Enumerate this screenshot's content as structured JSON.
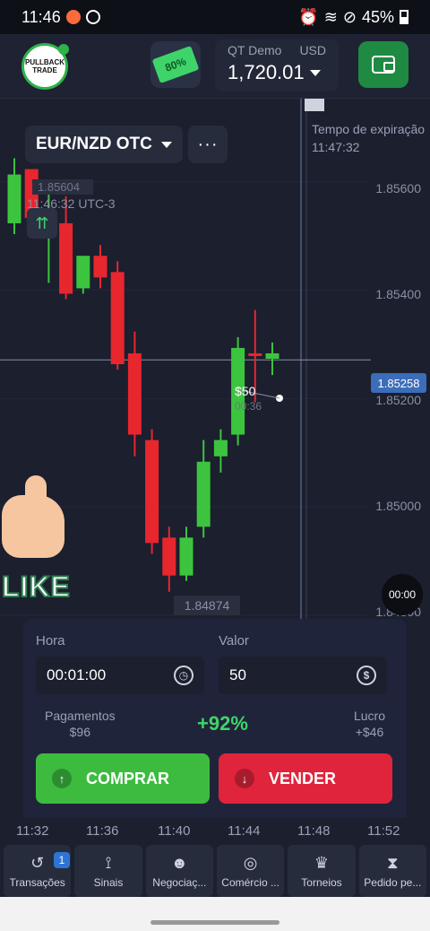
{
  "status_bar": {
    "time": "11:46",
    "battery": "45%"
  },
  "header": {
    "logo_text": "PULLBACK TRADE",
    "bonus_label": "80%",
    "account_type": "QT Demo",
    "currency": "USD",
    "balance": "1,720.01"
  },
  "chart": {
    "pair": "EUR/NZD OTC",
    "more": "···",
    "high_value": "1.85604",
    "current_time": "11:46:32 UTC-3",
    "expiry_title": "Tempo de expiração",
    "expiry_time": "11:47:32",
    "arrow": "⇈",
    "y_ticks": [
      "1.85600",
      "1.85400",
      "1.85200",
      "1.85000",
      "1.84800"
    ],
    "current_price": "1.85258",
    "low_value": "1.84874",
    "trade_amount": "$50",
    "trade_timer": "00:36",
    "countdown": "00:00",
    "like_text": "LIKE"
  },
  "chart_data": {
    "type": "candlestick",
    "ylim": [
      1.8478,
      1.8574
    ],
    "y_ticks": [
      1.856,
      1.854,
      1.852,
      1.85,
      1.848
    ],
    "candles": [
      {
        "o": 1.856,
        "h": 1.8563,
        "c": 1.8551,
        "l": 1.8549,
        "dir": "up"
      },
      {
        "o": 1.8552,
        "h": 1.856,
        "c": 1.8561,
        "l": 1.855,
        "dir": "down"
      },
      {
        "o": 1.8551,
        "h": 1.8558,
        "c": 1.8552,
        "l": 1.854,
        "dir": "up"
      },
      {
        "o": 1.8551,
        "h": 1.8556,
        "c": 1.8538,
        "l": 1.8537,
        "dir": "down"
      },
      {
        "o": 1.8539,
        "h": 1.8544,
        "c": 1.8545,
        "l": 1.8538,
        "dir": "up"
      },
      {
        "o": 1.8545,
        "h": 1.8547,
        "c": 1.8541,
        "l": 1.8539,
        "dir": "down"
      },
      {
        "o": 1.8542,
        "h": 1.8544,
        "c": 1.8525,
        "l": 1.8524,
        "dir": "down"
      },
      {
        "o": 1.8527,
        "h": 1.8531,
        "c": 1.8512,
        "l": 1.8508,
        "dir": "down"
      },
      {
        "o": 1.8511,
        "h": 1.8513,
        "c": 1.8492,
        "l": 1.849,
        "dir": "down"
      },
      {
        "o": 1.8493,
        "h": 1.8495,
        "c": 1.8486,
        "l": 1.8483,
        "dir": "down"
      },
      {
        "o": 1.8486,
        "h": 1.8495,
        "c": 1.8493,
        "l": 1.8485,
        "dir": "up"
      },
      {
        "o": 1.8495,
        "h": 1.8511,
        "c": 1.8507,
        "l": 1.8493,
        "dir": "up"
      },
      {
        "o": 1.8508,
        "h": 1.8513,
        "c": 1.8511,
        "l": 1.8505,
        "dir": "up"
      },
      {
        "o": 1.8512,
        "h": 1.853,
        "c": 1.8528,
        "l": 1.851,
        "dir": "up"
      },
      {
        "o": 1.8527,
        "h": 1.8535,
        "c": 1.8527,
        "l": 1.8518,
        "dir": "down"
      },
      {
        "o": 1.8526,
        "h": 1.8529,
        "c": 1.8527,
        "l": 1.8523,
        "dir": "up"
      }
    ],
    "current_price": 1.85258
  },
  "panel": {
    "time_label": "Hora",
    "time_value": "00:01:00",
    "amount_label": "Valor",
    "amount_value": "50",
    "payout_label": "Pagamentos",
    "payout_value": "$96",
    "payout_pct": "+92%",
    "profit_label": "Lucro",
    "profit_value": "+$46",
    "buy_label": "COMPRAR",
    "sell_label": "VENDER"
  },
  "x_axis": [
    "11:32",
    "11:36",
    "11:40",
    "11:44",
    "11:48",
    "11:52"
  ],
  "nav": [
    {
      "label": "Transações",
      "icon": "history-icon",
      "badge": "1"
    },
    {
      "label": "Sinais",
      "icon": "signal-icon"
    },
    {
      "label": "Negociaç...",
      "icon": "users-icon"
    },
    {
      "label": "Comércio ...",
      "icon": "target-icon"
    },
    {
      "label": "Torneios",
      "icon": "trophy-icon"
    },
    {
      "label": "Pedido pe...",
      "icon": "hourglass-icon"
    }
  ],
  "colors": {
    "up": "#3dc43f",
    "down": "#e8262e",
    "accent": "#3b6db8"
  }
}
